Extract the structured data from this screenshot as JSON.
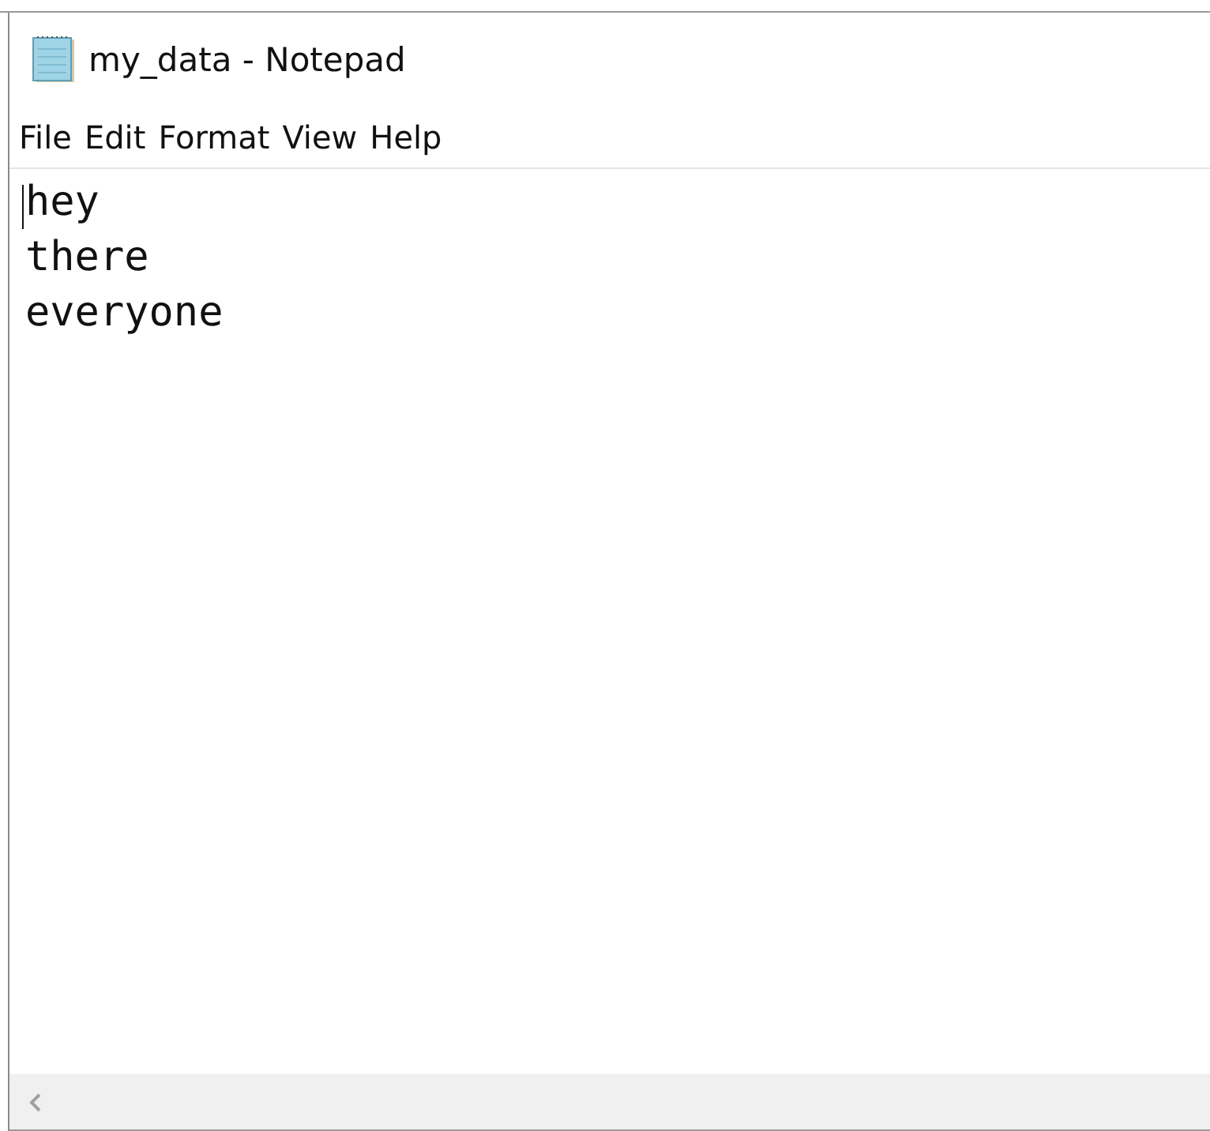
{
  "window": {
    "title": "my_data - Notepad"
  },
  "menu": [
    "File",
    "Edit",
    "Format",
    "View",
    "Help"
  ],
  "document": {
    "lines": [
      "hey",
      "there",
      "everyone"
    ]
  }
}
